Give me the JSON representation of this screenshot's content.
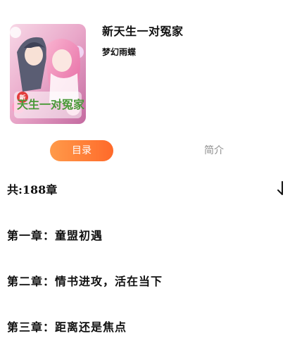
{
  "book": {
    "title": "新天生一对冤家",
    "author": "梦幻雨蝶",
    "cover": {
      "icon": "book-cover-image",
      "title_text": "天生一对冤家",
      "badge_text": "新"
    }
  },
  "tabs": [
    {
      "label": "目录",
      "active": true
    },
    {
      "label": "简介",
      "active": false
    }
  ],
  "colors": {
    "accent_start": "#ff9a4a",
    "accent_end": "#ff6a2a",
    "inactive_tab": "#8f8f8f"
  },
  "chapter_list": {
    "count_label": "共:188章",
    "sort_icon": "sort-arrow-icon",
    "chapters": [
      {
        "title": "第一章：童盟初遇"
      },
      {
        "title": "第二章：情书进攻，活在当下"
      },
      {
        "title": "第三章：距离还是焦点"
      }
    ]
  }
}
